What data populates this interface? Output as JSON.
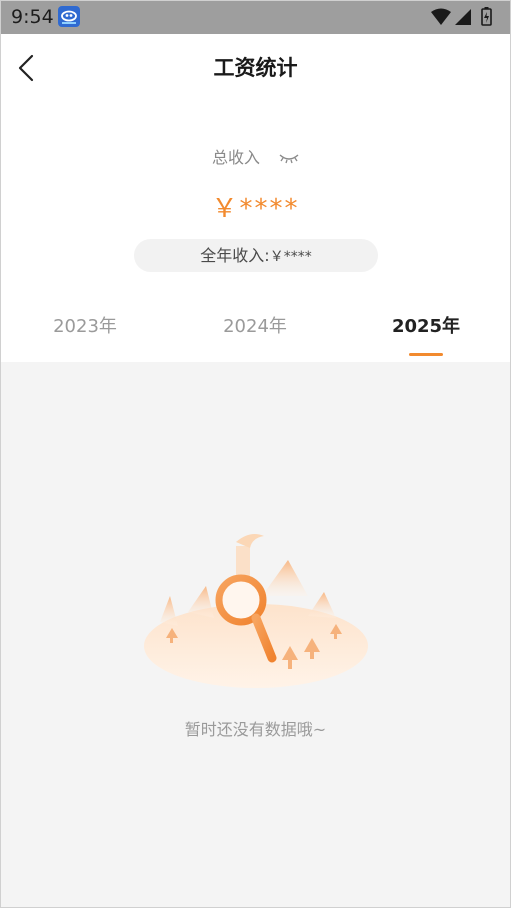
{
  "status_bar": {
    "time": "9:54",
    "icons": [
      "app-icon",
      "wifi-icon",
      "signal-icon",
      "battery-icon"
    ]
  },
  "header": {
    "title": "工资统计",
    "back_icon": "chevron-left-icon"
  },
  "income": {
    "label": "总收入",
    "hidden_icon": "eye-closed-icon",
    "total_masked": "￥****",
    "annual_label": "全年收入:",
    "annual_masked": "￥****"
  },
  "tabs": [
    {
      "label": "2023年",
      "active": false
    },
    {
      "label": "2024年",
      "active": false
    },
    {
      "label": "2025年",
      "active": true
    }
  ],
  "empty_state": {
    "message": "暂时还没有数据哦~",
    "illustration": "magnifier-empty-illustration"
  },
  "colors": {
    "accent": "#f28a2e",
    "status_bar": "#9e9e9e",
    "background": "#f4f4f4"
  }
}
